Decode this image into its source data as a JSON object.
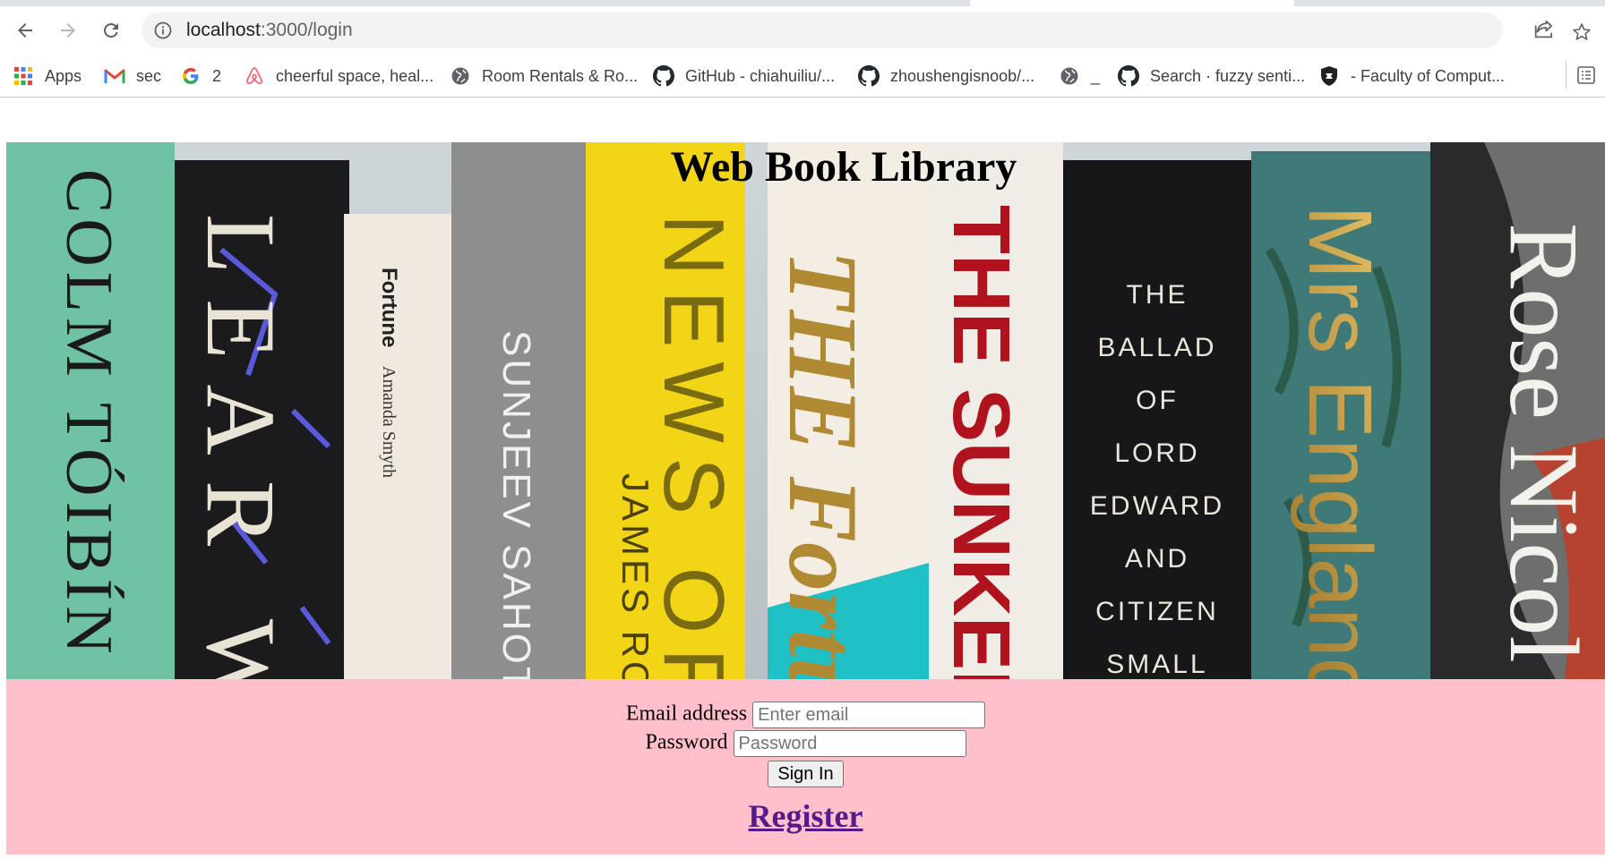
{
  "browser": {
    "url_host": "localhost",
    "url_path": ":3000/login",
    "bookmarks": [
      {
        "label": "Apps",
        "icon": "apps-grid-icon"
      },
      {
        "label": "sec",
        "icon": "gmail-icon"
      },
      {
        "label": "2",
        "icon": "google-icon"
      },
      {
        "label": "cheerful space, heal...",
        "icon": "airbnb-icon"
      },
      {
        "label": "Room Rentals & Ro...",
        "icon": "globe-icon"
      },
      {
        "label": "GitHub - chiahuiliu/...",
        "icon": "github-icon"
      },
      {
        "label": "zhoushengisnoob/...",
        "icon": "github-icon"
      },
      {
        "label": "_",
        "icon": "globe-icon"
      },
      {
        "label": "Search · fuzzy senti...",
        "icon": "github-icon"
      },
      {
        "label": "- Faculty of Comput...",
        "icon": "shield-icon"
      }
    ]
  },
  "page": {
    "title": "Web Book Library",
    "hero_spines": [
      "COLM TÓIBÍN",
      "LEAR W",
      "Fortune",
      "Amanda Smyth",
      "SUNJEEV SAHOTA",
      "NEWS OF",
      "JAMES RO",
      "THE Fortu",
      "THE SUNKEN RO",
      "THE BALLAD OF LORD EDWARD AND CITIZEN SMALL",
      "Mrs England",
      "Rose Nicol"
    ],
    "colors": {
      "form_background": "#ffc0cb",
      "link": "#551a8b"
    }
  },
  "form": {
    "email_label": "Email address",
    "email_placeholder": "Enter email",
    "password_label": "Password",
    "password_placeholder": "Password",
    "signin_label": "Sign In",
    "register_label": "Register"
  }
}
